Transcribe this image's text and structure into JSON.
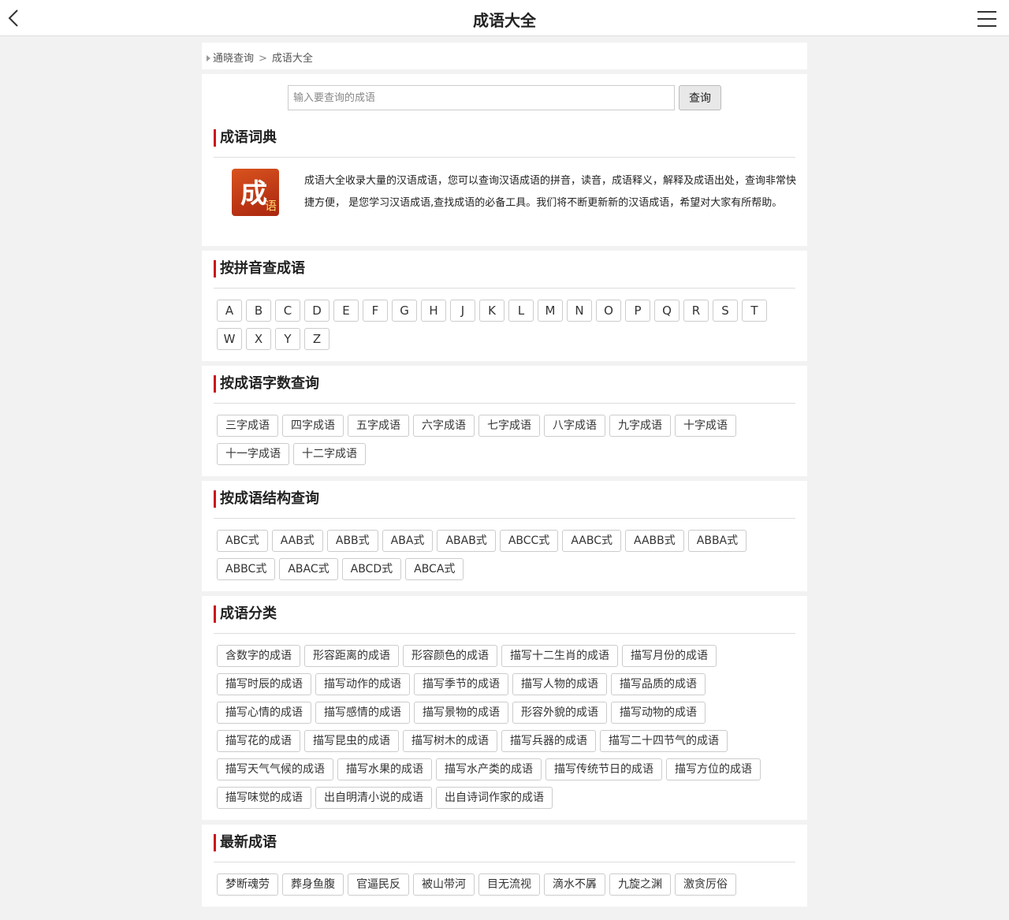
{
  "header": {
    "title": "成语大全"
  },
  "breadcrumb": {
    "home": "通晓查询",
    "sep": ">",
    "current": "成语大全"
  },
  "search": {
    "placeholder": "输入要查询的成语",
    "button": "查询"
  },
  "intro": {
    "heading": "成语词典",
    "logo_big": "成",
    "logo_small": "语",
    "text": "成语大全收录大量的汉语成语，您可以查询汉语成语的拼音，读音，成语释义，解释及成语出处，查询非常快捷方便， 是您学习汉语成语,查找成语的必备工具。我们将不断更新新的汉语成语，希望对大家有所帮助。"
  },
  "pinyin": {
    "heading": "按拼音查成语",
    "letters": [
      "A",
      "B",
      "C",
      "D",
      "E",
      "F",
      "G",
      "H",
      "J",
      "K",
      "L",
      "M",
      "N",
      "O",
      "P",
      "Q",
      "R",
      "S",
      "T",
      "W",
      "X",
      "Y",
      "Z"
    ]
  },
  "count": {
    "heading": "按成语字数查询",
    "items": [
      "三字成语",
      "四字成语",
      "五字成语",
      "六字成语",
      "七字成语",
      "八字成语",
      "九字成语",
      "十字成语",
      "十一字成语",
      "十二字成语"
    ]
  },
  "structure": {
    "heading": "按成语结构查询",
    "items": [
      "ABC式",
      "AAB式",
      "ABB式",
      "ABA式",
      "ABAB式",
      "ABCC式",
      "AABC式",
      "AABB式",
      "ABBA式",
      "ABBC式",
      "ABAC式",
      "ABCD式",
      "ABCA式"
    ]
  },
  "category": {
    "heading": "成语分类",
    "items": [
      "含数字的成语",
      "形容距离的成语",
      "形容颜色的成语",
      "描写十二生肖的成语",
      "描写月份的成语",
      "描写时辰的成语",
      "描写动作的成语",
      "描写季节的成语",
      "描写人物的成语",
      "描写品质的成语",
      "描写心情的成语",
      "描写感情的成语",
      "描写景物的成语",
      "形容外貌的成语",
      "描写动物的成语",
      "描写花的成语",
      "描写昆虫的成语",
      "描写树木的成语",
      "描写兵器的成语",
      "描写二十四节气的成语",
      "描写天气气候的成语",
      "描写水果的成语",
      "描写水产类的成语",
      "描写传统节日的成语",
      "描写方位的成语",
      "描写味觉的成语",
      "出自明清小说的成语",
      "出自诗词作家的成语"
    ]
  },
  "latest": {
    "heading": "最新成语",
    "items": [
      "梦断魂劳",
      "葬身鱼腹",
      "官逼民反",
      "被山带河",
      "目无流视",
      "滴水不羼",
      "九旋之渊",
      "激贪厉俗"
    ]
  }
}
